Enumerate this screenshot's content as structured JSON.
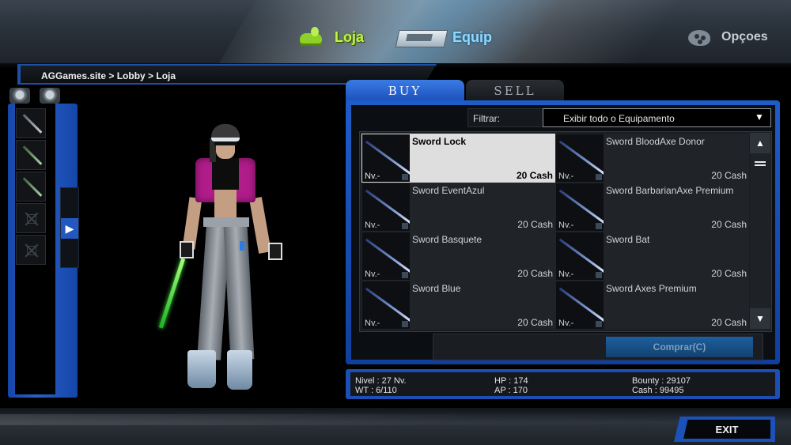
{
  "nav": {
    "loja_label": "Loja",
    "equip_label": "Equip",
    "opcoes_label": "Opçoes",
    "loja_color": "#c6f24a",
    "equip_color": "#8fd9ff"
  },
  "breadcrumb": "AGGames.site > Lobby > Loja",
  "tabs": {
    "buy": "BUY",
    "sell": "SELL"
  },
  "filter": {
    "label": "Filtrar:",
    "selected": "Exibir todo o Equipamento"
  },
  "items": [
    {
      "name": "Sword Lock",
      "level": "Nv.-",
      "price": "20 Cash",
      "selected": true
    },
    {
      "name": "Sword BloodAxe Donor",
      "level": "Nv.-",
      "price": "20 Cash"
    },
    {
      "name": "Sword EventAzul",
      "level": "Nv.-",
      "price": "20 Cash"
    },
    {
      "name": "Sword BarbarianAxe Premium",
      "level": "Nv.-",
      "price": "20 Cash"
    },
    {
      "name": "Sword Basquete",
      "level": "Nv.-",
      "price": "20 Cash"
    },
    {
      "name": "Sword Bat",
      "level": "Nv.-",
      "price": "20 Cash"
    },
    {
      "name": "Sword Blue",
      "level": "Nv.-",
      "price": "20 Cash"
    },
    {
      "name": "Sword Axes Premium",
      "level": "Nv.-",
      "price": "20 Cash"
    }
  ],
  "buy_button": "Comprar(C)",
  "stats": {
    "nivel": "Nivel : 27 Nv.",
    "wt": "WT : 6/110",
    "hp": "HP : 174",
    "ap": "AP : 170",
    "bounty": "Bounty : 29107",
    "cash": "Cash : 99495"
  },
  "exit_label": "EXIT",
  "icons": {
    "loja": "shop-hand-icon",
    "equip": "equipment-case-icon",
    "opcoes": "palette-icon",
    "scroll_up": "arrow-up-icon",
    "scroll_down": "arrow-down-icon",
    "expand": "arrow-right-icon",
    "dropdown": "chevron-down-icon"
  },
  "colors": {
    "frame_blue": "#1e5cc9",
    "selected_item_bg": "#dedede"
  }
}
